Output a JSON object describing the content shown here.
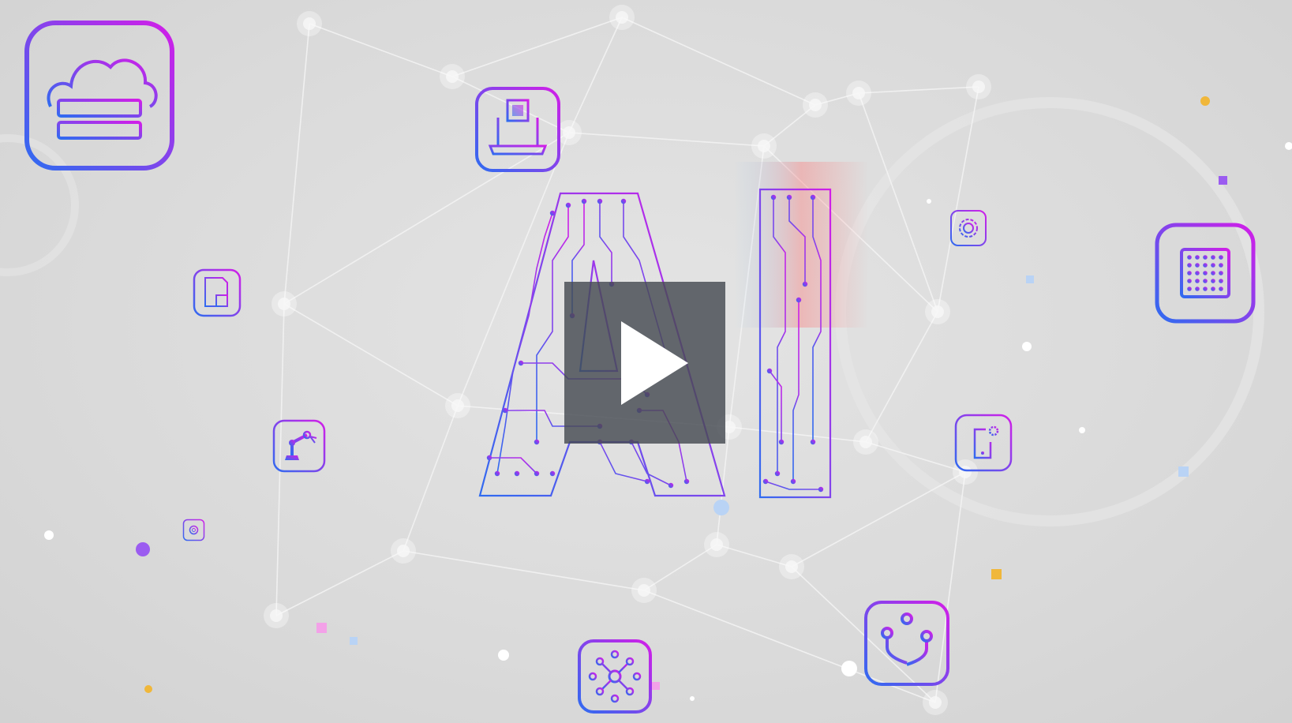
{
  "video": {
    "center_text": "AI",
    "state": "paused"
  },
  "colors": {
    "background": "#dcdcdc",
    "gradient_blue": "#2f6bf0",
    "gradient_magenta": "#d21ee8",
    "network_line": "#ffffff",
    "play_overlay": "#464a52",
    "play_triangle": "#ffffff"
  },
  "icons": [
    {
      "name": "cloud-server-icon"
    },
    {
      "name": "laptop-chip-icon"
    },
    {
      "name": "document-chip-icon"
    },
    {
      "name": "robot-arm-icon"
    },
    {
      "name": "small-gear-icon"
    },
    {
      "name": "gear-icon"
    },
    {
      "name": "processor-chip-icon"
    },
    {
      "name": "mobile-gear-icon"
    },
    {
      "name": "usb-icon"
    },
    {
      "name": "network-hub-icon"
    }
  ]
}
